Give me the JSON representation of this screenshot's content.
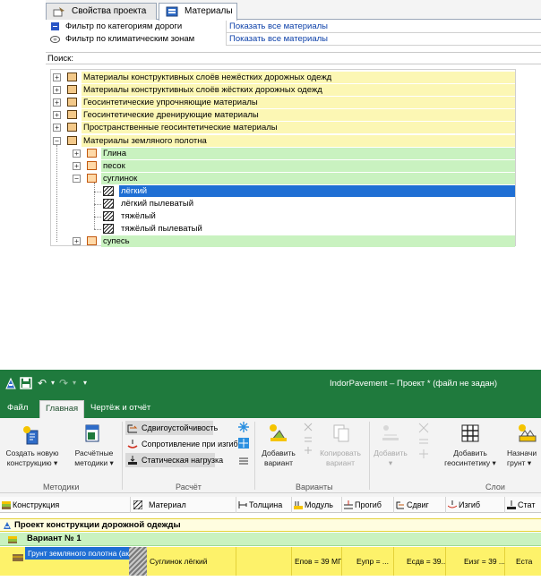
{
  "materials_panel": {
    "tabs": [
      {
        "label": "Свойства проекта",
        "active": false
      },
      {
        "label": "Материалы",
        "active": true
      }
    ],
    "filters": [
      {
        "label": "Фильтр по категориям дороги",
        "value": "Показать все материалы"
      },
      {
        "label": "Фильтр по климатическим зонам",
        "value": "Показать все материалы"
      }
    ],
    "search_label": "Поиск:",
    "tree": [
      {
        "label": "Материалы конструктивных слоёв нежёстких дорожных одежд",
        "level": 0,
        "expander": "+",
        "bg": "#fcf7b4"
      },
      {
        "label": "Материалы конструктивных слоёв жёстких дорожных одежд",
        "level": 0,
        "expander": "+",
        "bg": "#fcf7b4"
      },
      {
        "label": "Геосинтетические упрочняющие материалы",
        "level": 0,
        "expander": "+",
        "bg": "#fcf7b4"
      },
      {
        "label": "Геосинтетические дренирующие материалы",
        "level": 0,
        "expander": "+",
        "bg": "#fcf7b4"
      },
      {
        "label": "Пространственные геосинтетические материалы",
        "level": 0,
        "expander": "+",
        "bg": "#fcf7b4"
      },
      {
        "label": "Материалы земляного полотна",
        "level": 0,
        "expander": "−",
        "bg": "#fcf7b4"
      },
      {
        "label": "Глина",
        "level": 1,
        "expander": "+",
        "bg": "#c9f2c0"
      },
      {
        "label": "песок",
        "level": 1,
        "expander": "+",
        "bg": "#c9f2c0"
      },
      {
        "label": "суглинок",
        "level": 1,
        "expander": "−",
        "bg": "#c9f2c0"
      },
      {
        "label": "лёгкий",
        "level": 2,
        "expander": "",
        "bg": "#1f6fd4",
        "selected": true
      },
      {
        "label": "лёгкий пылеватый",
        "level": 2,
        "expander": "",
        "bg": "#ffffff"
      },
      {
        "label": "тяжёлый",
        "level": 2,
        "expander": "",
        "bg": "#ffffff"
      },
      {
        "label": "тяжёлый пылеватый",
        "level": 2,
        "expander": "",
        "bg": "#ffffff"
      },
      {
        "label": "супесь",
        "level": 1,
        "expander": "+",
        "bg": "#c9f2c0"
      }
    ]
  },
  "app": {
    "title": "IndorPavement – Проект * (файл не задан)",
    "menu": [
      {
        "label": "Файл",
        "active": false
      },
      {
        "label": "Главная",
        "active": true
      },
      {
        "label": "Чертёж и отчёт",
        "active": false
      }
    ],
    "ribbon": {
      "btn_create": [
        "Создать новую",
        "конструкцию ▾"
      ],
      "btn_methods": [
        "Расчётные",
        "методики ▾"
      ],
      "small_buttons": [
        "Сдвигоустойчивость",
        "Сопротивление при изгибе",
        "Статическая нагрузка"
      ],
      "btn_add_variant": [
        "Добавить",
        "вариант"
      ],
      "btn_copy_variant": [
        "Копировать",
        "вариант"
      ],
      "btn_add_layer": [
        "Добавить",
        "▾"
      ],
      "btn_add_geosynth": [
        "Добавить",
        "геосинтетику ▾"
      ],
      "btn_assign_soil": [
        "Назначи",
        "грунт ▾"
      ],
      "groups": [
        "Методики",
        "Расчёт",
        "Варианты",
        "Слои"
      ]
    },
    "columns": [
      "Конструкция",
      "Материал",
      "Толщина",
      "Модуль",
      "Прогиб",
      "Сдвиг",
      "Изгиб",
      "Стат"
    ],
    "rows": {
      "project": "Проект конструкции дорожной одежды",
      "variant": "Вариант № 1",
      "layer": {
        "name": "Грунт земляного полотна (акти",
        "material": "Суглинок лёгкий",
        "thickness": "",
        "modulus": "Eпов = 39 МПа",
        "deflection": "Eупр = ...",
        "shear": "Eсдв = 39...",
        "bending": "Eизг = 39 ...",
        "static": "Еста"
      }
    },
    "colors": {
      "titlebar": "#1f7a3d",
      "selection": "#1f6fd4",
      "row_yellow": "#fdf26a",
      "row_green": "#c9f2c0"
    }
  }
}
